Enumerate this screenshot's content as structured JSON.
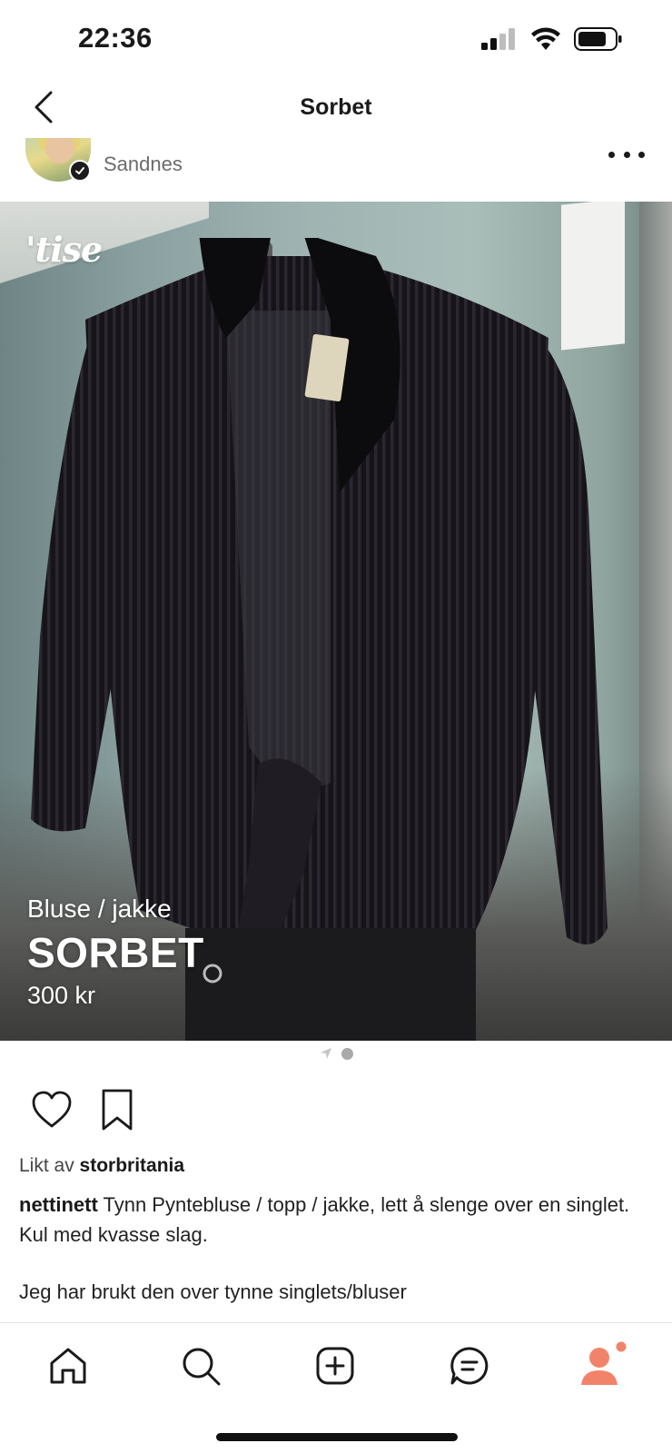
{
  "status_bar": {
    "time": "22:36"
  },
  "nav": {
    "title": "Sorbet"
  },
  "seller": {
    "location": "Sandnes"
  },
  "product": {
    "logo_text": "tise",
    "category": "Bluse / jakke",
    "brand": "SORBET",
    "price": "300 kr",
    "image_count": 2,
    "current_image": 2
  },
  "social": {
    "likes_prefix": "Likt av",
    "liked_by": "storbritania",
    "caption_user": "nettinett",
    "caption_text": "Tynn Pyntebluse / topp / jakke, lett å slenge over en singlet. Kul med kvasse slag.",
    "caption_text_2": "Jeg har brukt den over tynne singlets/bluser"
  },
  "tabbar": {
    "items": [
      "home-icon",
      "search-icon",
      "add-icon",
      "chat-icon",
      "profile-icon"
    ],
    "accent_color": "#f2836b",
    "notification_dot": true
  },
  "colors": {
    "text": "#1a1a1a",
    "muted": "#6b6b6b",
    "accent": "#f2836b"
  }
}
